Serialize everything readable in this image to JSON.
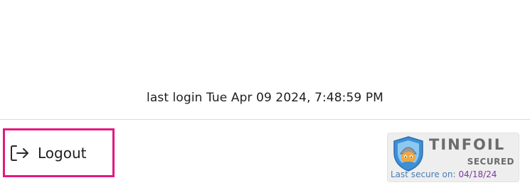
{
  "session": {
    "last_login": "last login Tue Apr 09 2024, 7:48:59 PM"
  },
  "logout": {
    "label": "Logout",
    "icon": "logout-arrow-icon",
    "highlight_color": "#e4197f"
  },
  "tinfoil_badge": {
    "brand": "TINFOIL",
    "status": "SECURED",
    "last_secure_label": "Last secure on:",
    "last_secure_date": "04/18/24",
    "icon": "shield-mascot-icon"
  }
}
